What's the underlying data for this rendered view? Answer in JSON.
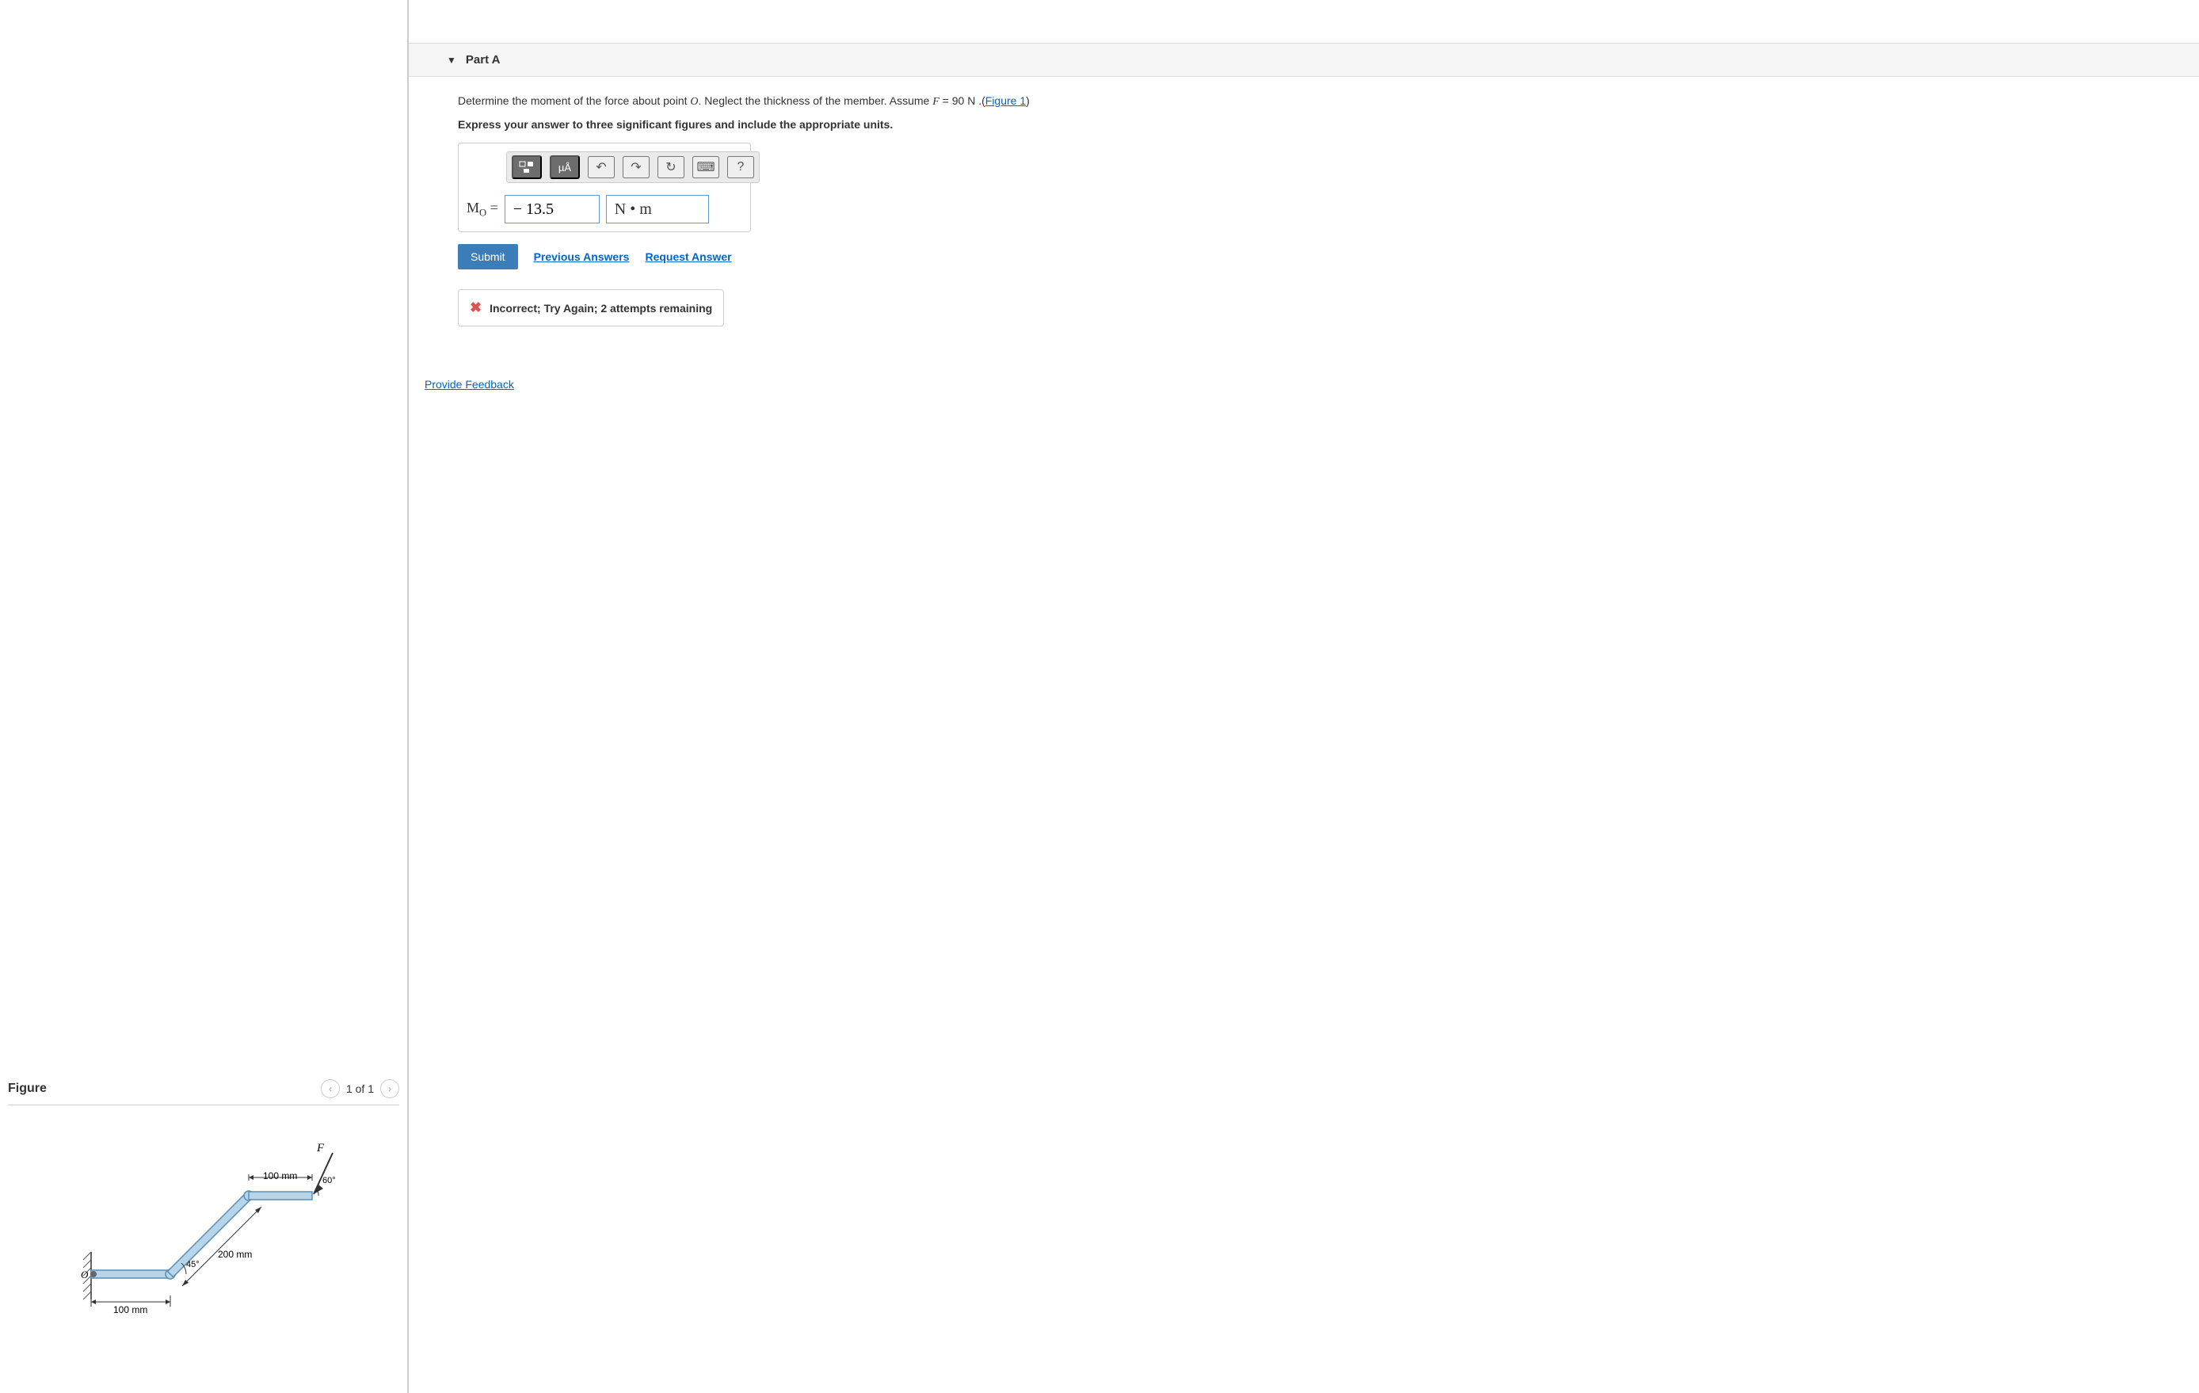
{
  "figure": {
    "title": "Figure",
    "nav_count": "1 of 1",
    "labels": {
      "force": "F",
      "top_dim": "100 mm",
      "angle_top": "60°",
      "angle_bottom": "45°",
      "diag_dim": "200 mm",
      "bottom_dim": "100 mm",
      "origin": "O"
    }
  },
  "part": {
    "title": "Part A",
    "question_prefix": "Determine the moment of the force about point ",
    "question_var1": "O",
    "question_mid": ". Neglect the thickness of the member. Assume ",
    "question_var2": "F",
    "question_eq": " = 90 N",
    "question_suffix": " .(",
    "figure_link": "Figure 1",
    "question_end": ")",
    "instruction": "Express your answer to three significant figures and include the appropriate units.",
    "toolbar": {
      "units_label": "µÅ",
      "help": "?"
    },
    "answer": {
      "label_m": "M",
      "label_o": "O",
      "label_eq": " = ",
      "value": "− 13.5",
      "unit": "N • m"
    },
    "submit": "Submit",
    "previous_answers": "Previous Answers",
    "request_answer": "Request Answer",
    "feedback": {
      "text": "Incorrect; Try Again; 2 attempts remaining"
    }
  },
  "provide_feedback": "Provide Feedback"
}
